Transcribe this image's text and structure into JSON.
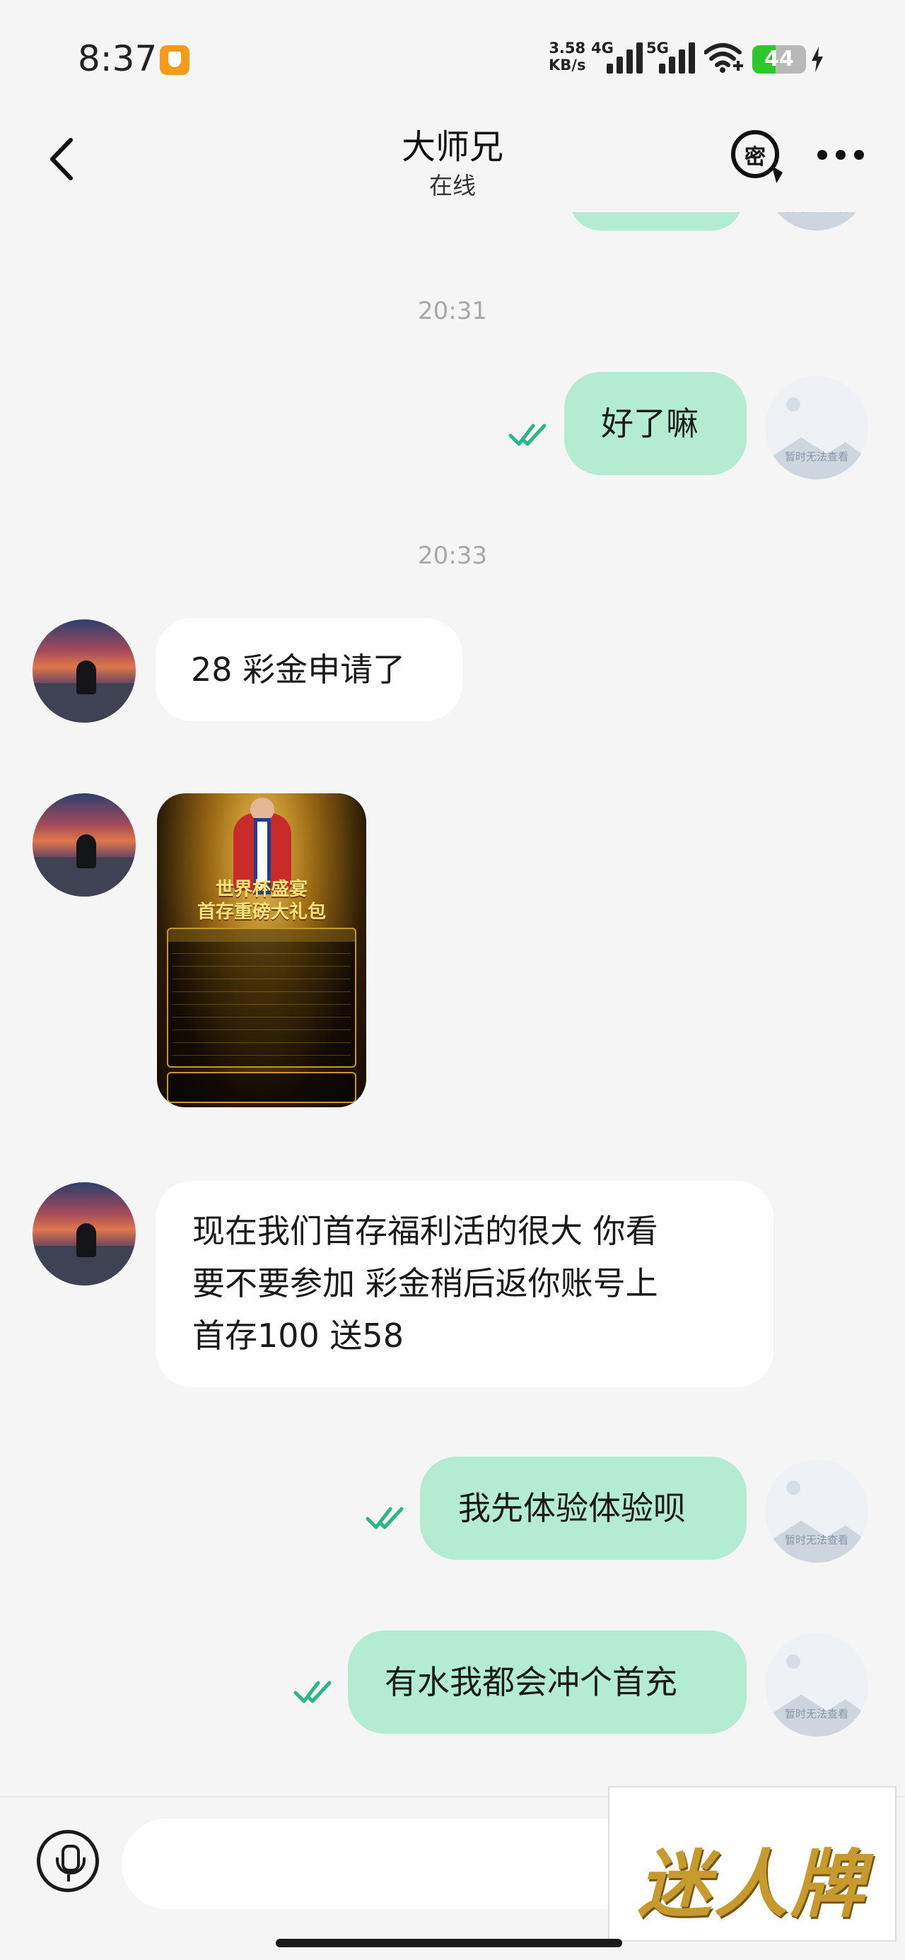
{
  "status_bar": {
    "time": "8:37",
    "net_speed_value": "3.58",
    "net_speed_unit": "KB/s",
    "net_type_1": "4G",
    "net_type_2": "5G",
    "battery": "44",
    "battery_level": 0.44,
    "icons": [
      "app-notification-icon",
      "signal-icon",
      "wifi-icon",
      "battery-icon",
      "charging-icon"
    ]
  },
  "header": {
    "title": "大师兄",
    "status": "在线",
    "secret_label": "密",
    "icons": [
      "back-icon",
      "secret-chat-icon",
      "more-icon"
    ]
  },
  "messages": [
    {
      "type": "time",
      "text": "20:31"
    },
    {
      "type": "out",
      "text": "好了嘛",
      "read": true
    },
    {
      "type": "time",
      "text": "20:33"
    },
    {
      "type": "in",
      "text": "28 彩金申请了"
    },
    {
      "type": "in-image",
      "title_line_1": "世界杯盛宴",
      "title_line_2": "首存重磅大礼包"
    },
    {
      "type": "in",
      "lines": [
        "现在我们首存福利活的很大 你看",
        "要不要参加 彩金稍后返你账号上",
        "首存100 送58"
      ]
    },
    {
      "type": "out",
      "text": "我先体验体验呗",
      "read": true
    },
    {
      "type": "out",
      "text": "有水我都会冲个首充",
      "read": true
    }
  ],
  "my_avatar_caption": "暂时无法查看",
  "input": {
    "placeholder": "",
    "value": ""
  },
  "watermark": "迷人牌",
  "colors": {
    "background": "#f5f5f5",
    "bubble_in": "#ffffff",
    "bubble_out": "#b3ebd3",
    "read_check": "#2bb68a",
    "battery_green": "#2bc72b"
  }
}
